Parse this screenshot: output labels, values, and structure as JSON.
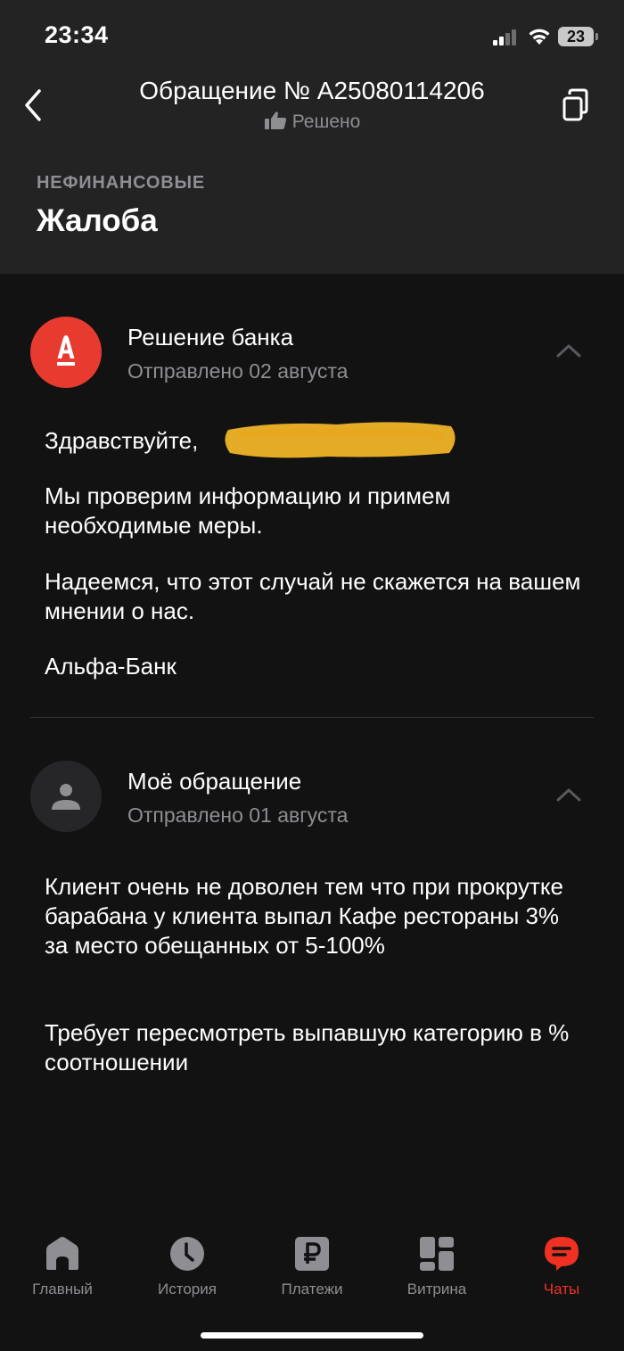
{
  "status_bar": {
    "time": "23:34",
    "battery": "23"
  },
  "header": {
    "title": "Обращение № A25080114206",
    "status": "Решено",
    "category": "НЕФИНАНСОВЫЕ",
    "heading": "Жалоба"
  },
  "messages": [
    {
      "author": "Решение банка",
      "date": "Отправлено 02 августа",
      "paragraphs": [
        "Здравствуйте,",
        "Мы проверим информацию и примем необходимые меры.",
        "Надеемся, что этот случай не скажется на вашем мнении о нас.",
        "Альфа-Банк"
      ]
    },
    {
      "author": "Моё обращение",
      "date": "Отправлено 01 августа",
      "paragraphs": [
        "Клиент очень не доволен тем что при прокрутке барабана у клиента выпал Кафе рестораны 3% за место обещанных от 5-100%",
        "Требует пересмотреть выпавшую категорию в % соотношении"
      ]
    }
  ],
  "tabbar": {
    "items": [
      {
        "label": "Главный",
        "icon": "home-icon"
      },
      {
        "label": "История",
        "icon": "clock-icon"
      },
      {
        "label": "Платежи",
        "icon": "ruble-icon"
      },
      {
        "label": "Витрина",
        "icon": "showcase-icon"
      },
      {
        "label": "Чаты",
        "icon": "chat-icon",
        "active": true
      }
    ]
  },
  "colors": {
    "accent": "#ef3124",
    "bank_avatar": "#e63b2e",
    "header_bg": "#232324",
    "page_bg": "#121212",
    "redaction": "#f0b429"
  }
}
